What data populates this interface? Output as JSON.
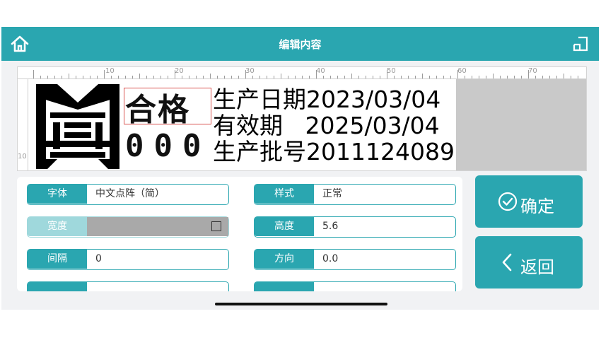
{
  "header": {
    "title": "编辑内容",
    "home_icon": "home-icon",
    "exit_icon": "exit-icon"
  },
  "ruler": {
    "labels": [
      "10",
      "20",
      "30",
      "40",
      "50",
      "60",
      "70"
    ],
    "vertical_label": "10"
  },
  "preview": {
    "hege_text": "合格",
    "zeros_text": "000",
    "line1": "生产日期2023/03/04",
    "line2": "有效期   2025/03/04",
    "line3": "生产批号2011124089"
  },
  "form": {
    "font": {
      "label": "字体",
      "value": "中文点阵（简）"
    },
    "style": {
      "label": "样式",
      "value": "正常"
    },
    "width": {
      "label": "宽度"
    },
    "height": {
      "label": "高度",
      "value": "5.6"
    },
    "spacing": {
      "label": "间隔",
      "value": "0"
    },
    "direction": {
      "label": "方向",
      "value": "0.0"
    }
  },
  "buttons": {
    "confirm": "确定",
    "back": "返回"
  },
  "colors": {
    "accent": "#2aa6b0",
    "disabled_accent": "#9fd8dc",
    "highlight_border": "#d9534f"
  }
}
